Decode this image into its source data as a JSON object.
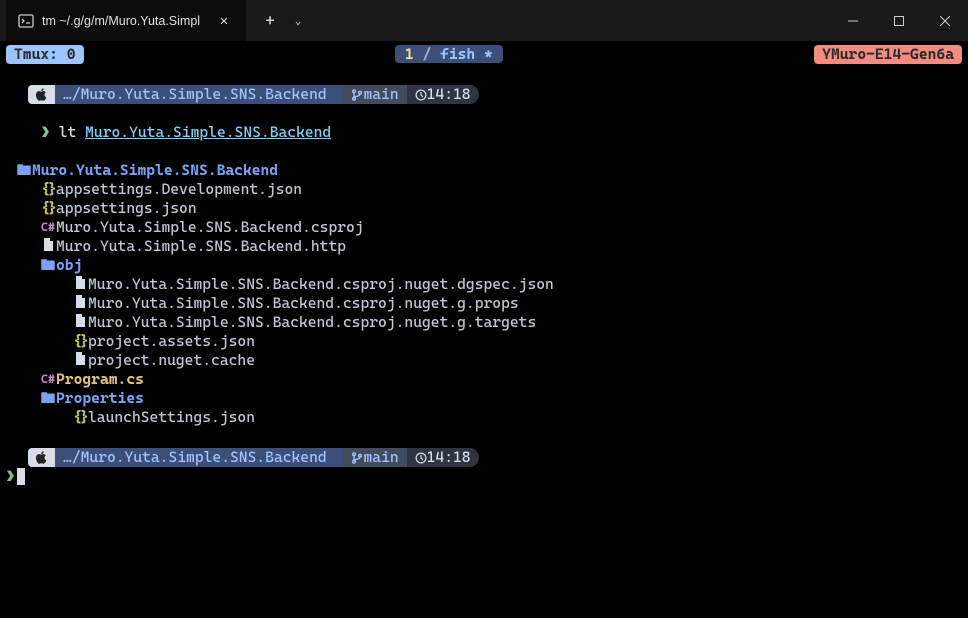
{
  "window": {
    "tab_title": "tm ~/.g/g/m/Muro.Yuta.Simpl",
    "new_tab": "+",
    "dropdown": "⌄"
  },
  "status": {
    "tmux": "Tmux: 0",
    "pane_num": "1",
    "slash": "/",
    "shell": "fish *",
    "host": "YMuro-E14-Gen6a"
  },
  "prompt": {
    "apple": "",
    "path": "…/Muro.Yuta.Simple.SNS.Backend",
    "branch_icon": "⎇",
    "branch": " main",
    "clock_icon": "◷",
    "time": "14:18"
  },
  "command": {
    "chevron": "❯",
    "cmd": "lt",
    "arg": "Muro.Yuta.Simple.SNS.Backend"
  },
  "tree": {
    "root": "Muro.Yuta.Simple.SNS.Backend",
    "items": [
      {
        "indent": 1,
        "icon": "json",
        "name": "appsettings.Development.json"
      },
      {
        "indent": 1,
        "icon": "json",
        "name": "appsettings.json"
      },
      {
        "indent": 1,
        "icon": "cs",
        "name": "Muro.Yuta.Simple.SNS.Backend.csproj"
      },
      {
        "indent": 1,
        "icon": "file",
        "name": "Muro.Yuta.Simple.SNS.Backend.http"
      },
      {
        "indent": 1,
        "icon": "folder",
        "name": "obj",
        "folder": true
      },
      {
        "indent": 2,
        "icon": "file",
        "name": "Muro.Yuta.Simple.SNS.Backend.csproj.nuget.dgspec.json"
      },
      {
        "indent": 2,
        "icon": "file",
        "name": "Muro.Yuta.Simple.SNS.Backend.csproj.nuget.g.props"
      },
      {
        "indent": 2,
        "icon": "file",
        "name": "Muro.Yuta.Simple.SNS.Backend.csproj.nuget.g.targets"
      },
      {
        "indent": 2,
        "icon": "json",
        "name": "project.assets.json"
      },
      {
        "indent": 2,
        "icon": "file",
        "name": "project.nuget.cache"
      },
      {
        "indent": 1,
        "icon": "cs",
        "name": "Program.cs",
        "prog": true
      },
      {
        "indent": 1,
        "icon": "folder",
        "name": "Properties",
        "folder": true
      },
      {
        "indent": 2,
        "icon": "json",
        "name": "launchSettings.json"
      }
    ]
  },
  "icons": {
    "folder": "🖿",
    "json": "{}",
    "cs": "C#",
    "file": "🖹"
  }
}
